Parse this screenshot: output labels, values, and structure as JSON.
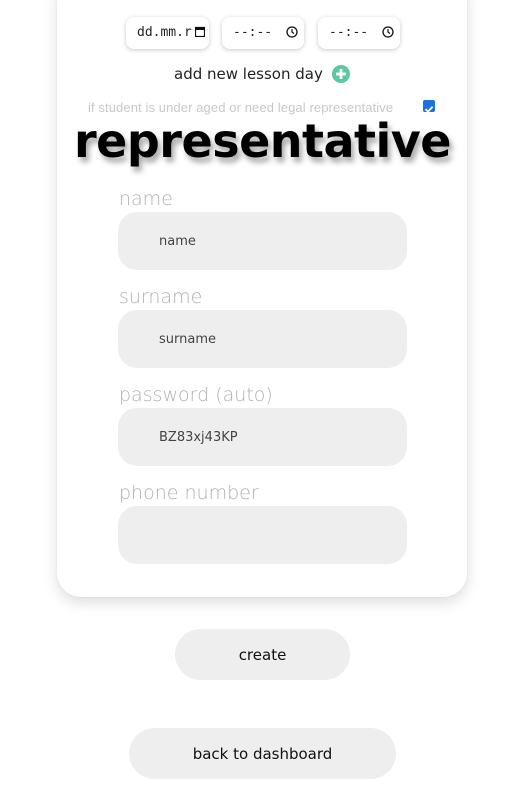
{
  "lesson_schedule": {
    "date_placeholder": "dd.mm.r",
    "start_time_placeholder": "--:--",
    "end_time_placeholder": "--:--",
    "add_day_label": "add new lesson day",
    "add_day_icon": "plus-circle-icon",
    "accent_color": "#5cc7a0"
  },
  "representative": {
    "checkbox_label": "if student is under aged or need legal representative",
    "checked": true,
    "heading": "representative",
    "fields": [
      {
        "label": "name",
        "placeholder": "name",
        "value": ""
      },
      {
        "label": "surname",
        "placeholder": "surname",
        "value": ""
      },
      {
        "label": "password (auto)",
        "placeholder": "",
        "value": "BZ83xj43KP"
      },
      {
        "label": "phone number",
        "placeholder": "",
        "value": ""
      }
    ]
  },
  "actions": {
    "create_label": "create",
    "back_label": "back to dashboard"
  },
  "colors": {
    "checkbox": "#1e6fe0",
    "input_bg": "#eeeeee",
    "label_gray": "#b0b0b0"
  }
}
